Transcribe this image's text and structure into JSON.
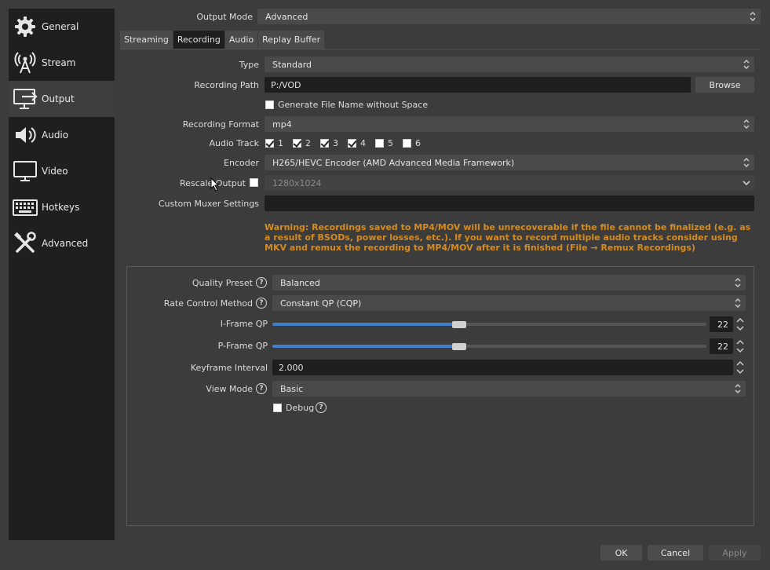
{
  "sidebar": {
    "items": [
      {
        "label": "General",
        "icon": "gear-icon"
      },
      {
        "label": "Stream",
        "icon": "broadcast-tower-icon"
      },
      {
        "label": "Output",
        "icon": "output-monitor-icon"
      },
      {
        "label": "Audio",
        "icon": "speaker-icon"
      },
      {
        "label": "Video",
        "icon": "monitor-icon"
      },
      {
        "label": "Hotkeys",
        "icon": "keyboard-icon"
      },
      {
        "label": "Advanced",
        "icon": "tools-icon"
      }
    ],
    "active_index": 2
  },
  "output_mode": {
    "label": "Output Mode",
    "value": "Advanced"
  },
  "tabs": [
    "Streaming",
    "Recording",
    "Audio",
    "Replay Buffer"
  ],
  "active_tab": "Recording",
  "recording": {
    "type_label": "Type",
    "type_value": "Standard",
    "path_label": "Recording Path",
    "path_value": "P:/VOD",
    "browse_label": "Browse",
    "gen_filename_label": "Generate File Name without Space",
    "gen_filename_checked": false,
    "format_label": "Recording Format",
    "format_value": "mp4",
    "audio_track_label": "Audio Track",
    "audio_tracks": [
      {
        "label": "1",
        "checked": true
      },
      {
        "label": "2",
        "checked": true
      },
      {
        "label": "3",
        "checked": true
      },
      {
        "label": "4",
        "checked": true
      },
      {
        "label": "5",
        "checked": false
      },
      {
        "label": "6",
        "checked": false
      }
    ],
    "encoder_label": "Encoder",
    "encoder_value": "H265/HEVC Encoder (AMD Advanced Media Framework)",
    "rescale_label": "Rescale Output",
    "rescale_checked": false,
    "rescale_value": "1280x1024",
    "muxer_label": "Custom Muxer Settings",
    "muxer_value": "",
    "warning": "Warning: Recordings saved to MP4/MOV will be unrecoverable if the file cannot be finalized (e.g. as a result of BSODs, power losses, etc.). If you want to record multiple audio tracks consider using MKV and remux the recording to MP4/MOV after it is finished (File → Remux Recordings)"
  },
  "encoder_settings": {
    "quality_preset_label": "Quality Preset",
    "quality_preset_value": "Balanced",
    "rate_control_label": "Rate Control Method",
    "rate_control_value": "Constant QP (CQP)",
    "iframe_label": "I-Frame QP",
    "iframe_value": "22",
    "iframe_fraction": 0.43,
    "pframe_label": "P-Frame QP",
    "pframe_value": "22",
    "pframe_fraction": 0.43,
    "keyframe_label": "Keyframe Interval",
    "keyframe_value": "2.000",
    "view_mode_label": "View Mode",
    "view_mode_value": "Basic",
    "debug_label": "Debug",
    "debug_checked": false,
    "help_glyph": "?"
  },
  "buttons": {
    "ok": "OK",
    "cancel": "Cancel",
    "apply": "Apply"
  },
  "colors": {
    "accent": "#3f7fd0",
    "warning": "#d68b1e"
  }
}
